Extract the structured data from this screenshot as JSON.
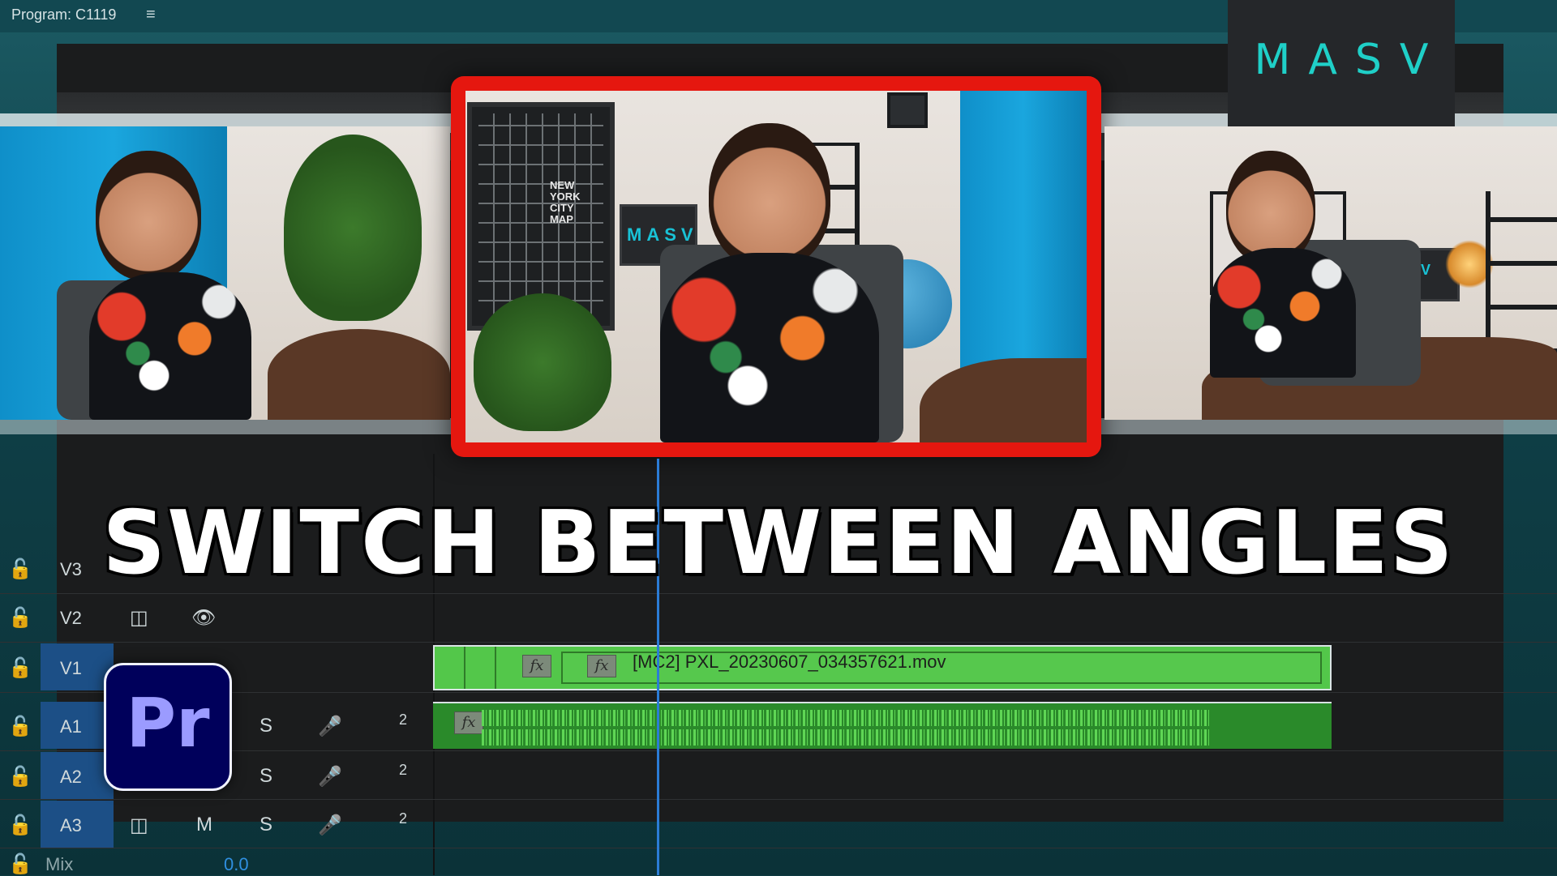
{
  "panel": {
    "program_label": "Program: C1119",
    "menu_icon": "hamburger-menu-icon"
  },
  "brand": {
    "logo": "MASV",
    "accent": "#1fd0c8",
    "highlight_border": "#e5170f"
  },
  "headline": "SWITCH BETWEEN ANGLES",
  "scenes": {
    "poster_text": "NEW\nYORK\nCITY\nMAP",
    "laptop_text": "MASV",
    "laptop_text_right": "ASV"
  },
  "tracks": [
    {
      "id": "v3",
      "name": "V3",
      "lock_icon": "lock-open-icon"
    },
    {
      "id": "v2",
      "name": "V2",
      "lock_icon": "lock-open-icon",
      "controls": [
        "film-strip-icon",
        "eye-icon"
      ]
    },
    {
      "id": "v1",
      "name": "V1",
      "lock_icon": "lock-open-icon",
      "selected": true
    },
    {
      "id": "a1",
      "name": "A1",
      "lock_icon": "lock-open-icon",
      "solo": "S",
      "mic_icon": "microphone-icon",
      "channel": "2",
      "selected": true
    },
    {
      "id": "a2",
      "name": "A2",
      "lock_icon": "lock-open-icon",
      "solo": "S",
      "mic_icon": "microphone-icon",
      "channel": "2",
      "selected": true
    },
    {
      "id": "a3",
      "name": "A3",
      "lock_icon": "lock-open-icon",
      "mute": "M",
      "solo": "S",
      "mic_icon": "microphone-icon",
      "channel": "2",
      "selected": true
    }
  ],
  "mix": {
    "label": "Mix",
    "value": "0.0"
  },
  "clip": {
    "title": "[MC2] PXL_20230607_034357621.mov",
    "fx": "fx"
  },
  "app_icon": {
    "label": "Pr",
    "name": "premiere-pro-icon"
  }
}
